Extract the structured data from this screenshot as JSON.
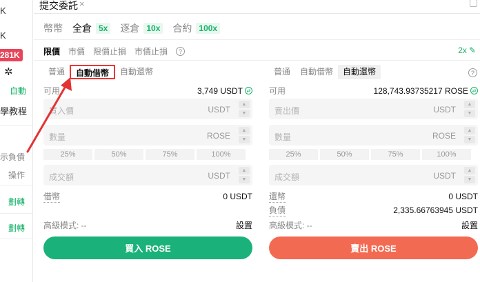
{
  "left_strip": {
    "line1": "K",
    "line2": "K",
    "badge": "281K",
    "auto_label": "自動",
    "tutorial": "學教程",
    "show_debt": "示負債",
    "action": "操作",
    "transfer1": "劃轉",
    "transfer2": "劃轉"
  },
  "tab": {
    "title": "提交委託",
    "close": "×"
  },
  "margin_modes": [
    {
      "label": "幣幣"
    },
    {
      "label": "全倉",
      "leverage": "5x"
    },
    {
      "label": "逐倉",
      "leverage": "10x"
    },
    {
      "label": "合約",
      "leverage": "100x"
    }
  ],
  "order_types": [
    "限價",
    "市價",
    "限價止損",
    "市價止損"
  ],
  "leverage_edit": "2x",
  "buy_panel": {
    "subtabs": [
      "普通",
      "自動借幣",
      "自動還幣"
    ],
    "available_label": "可用",
    "available_value": "3,749 USDT",
    "price_placeholder": "買入價",
    "price_unit": "USDT",
    "qty_placeholder": "數量",
    "qty_unit": "ROSE",
    "percents": [
      "25%",
      "50%",
      "75%",
      "100%"
    ],
    "total_placeholder": "成交額",
    "total_unit": "USDT",
    "borrow_label": "借幣",
    "borrow_value": "0 USDT",
    "advanced_label": "高級模式: --",
    "settings": "設置",
    "button": "買入 ROSE"
  },
  "sell_panel": {
    "subtabs": [
      "普通",
      "自動借幣",
      "自動還幣"
    ],
    "available_label": "可用",
    "available_value": "128,743.93735217 ROSE",
    "price_placeholder": "賣出價",
    "price_unit": "USDT",
    "qty_placeholder": "數量",
    "qty_unit": "ROSE",
    "percents": [
      "25%",
      "50%",
      "75%",
      "100%"
    ],
    "total_placeholder": "成交額",
    "total_unit": "USDT",
    "repay_label": "還幣",
    "repay_value": "0 USDT",
    "debt_label": "負債",
    "debt_value": "2,335.66763945 USDT",
    "advanced_label": "高級模式: --",
    "settings": "設置",
    "button": "賣出 ROSE"
  },
  "colors": {
    "green": "#1ab27a",
    "red": "#f36a52",
    "badge": "#e8455a",
    "highlight": "#e33333"
  }
}
